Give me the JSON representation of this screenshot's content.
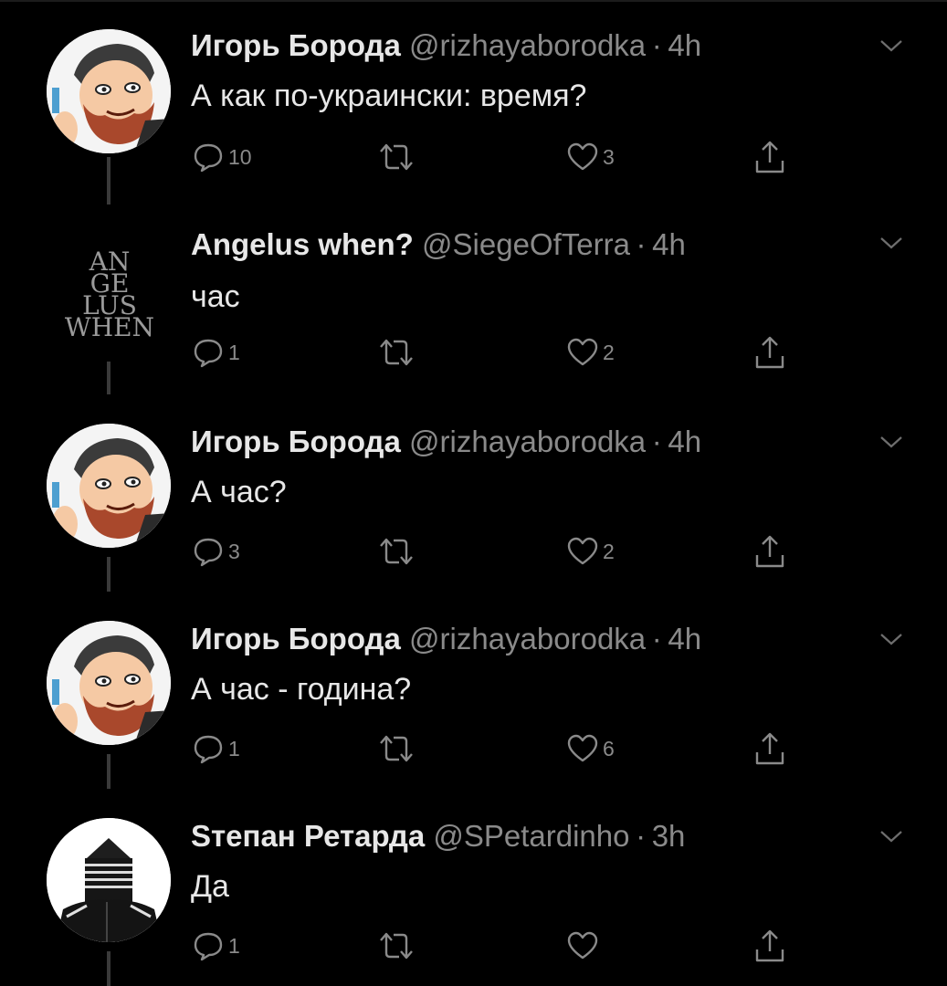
{
  "colors": {
    "background": "#000000",
    "name": "#e7e7e7",
    "muted": "#8a8a8a",
    "thread_line": "#3a3a3a"
  },
  "separator": "·",
  "tweets": [
    {
      "name": "Игорь Борода",
      "handle": "@rizhayaborodka",
      "time": "4h",
      "text": "А как по-украински: время?",
      "replies": "10",
      "retweets": "",
      "likes": "3",
      "avatar": "bearded-man-avatar"
    },
    {
      "name": "Angelus when?",
      "handle": "@SiegeOfTerra",
      "time": "4h",
      "text": "час",
      "replies": "1",
      "retweets": "",
      "likes": "2",
      "avatar": "angelus-when-text-avatar",
      "avatar_text": [
        "AN",
        "GE",
        "LUS",
        "WHEN"
      ]
    },
    {
      "name": "Игорь Борода",
      "handle": "@rizhayaborodka",
      "time": "4h",
      "text": "А час?",
      "replies": "3",
      "retweets": "",
      "likes": "2",
      "avatar": "bearded-man-avatar"
    },
    {
      "name": "Игорь Борода",
      "handle": "@rizhayaborodka",
      "time": "4h",
      "text": "А час - година?",
      "replies": "1",
      "retweets": "",
      "likes": "6",
      "avatar": "bearded-man-avatar"
    },
    {
      "name": "Sтепан Ретарда",
      "handle": "@SPetardinho",
      "time": "3h",
      "text": "Да",
      "replies": "1",
      "retweets": "",
      "likes": "",
      "avatar": "hooded-figure-avatar"
    }
  ]
}
